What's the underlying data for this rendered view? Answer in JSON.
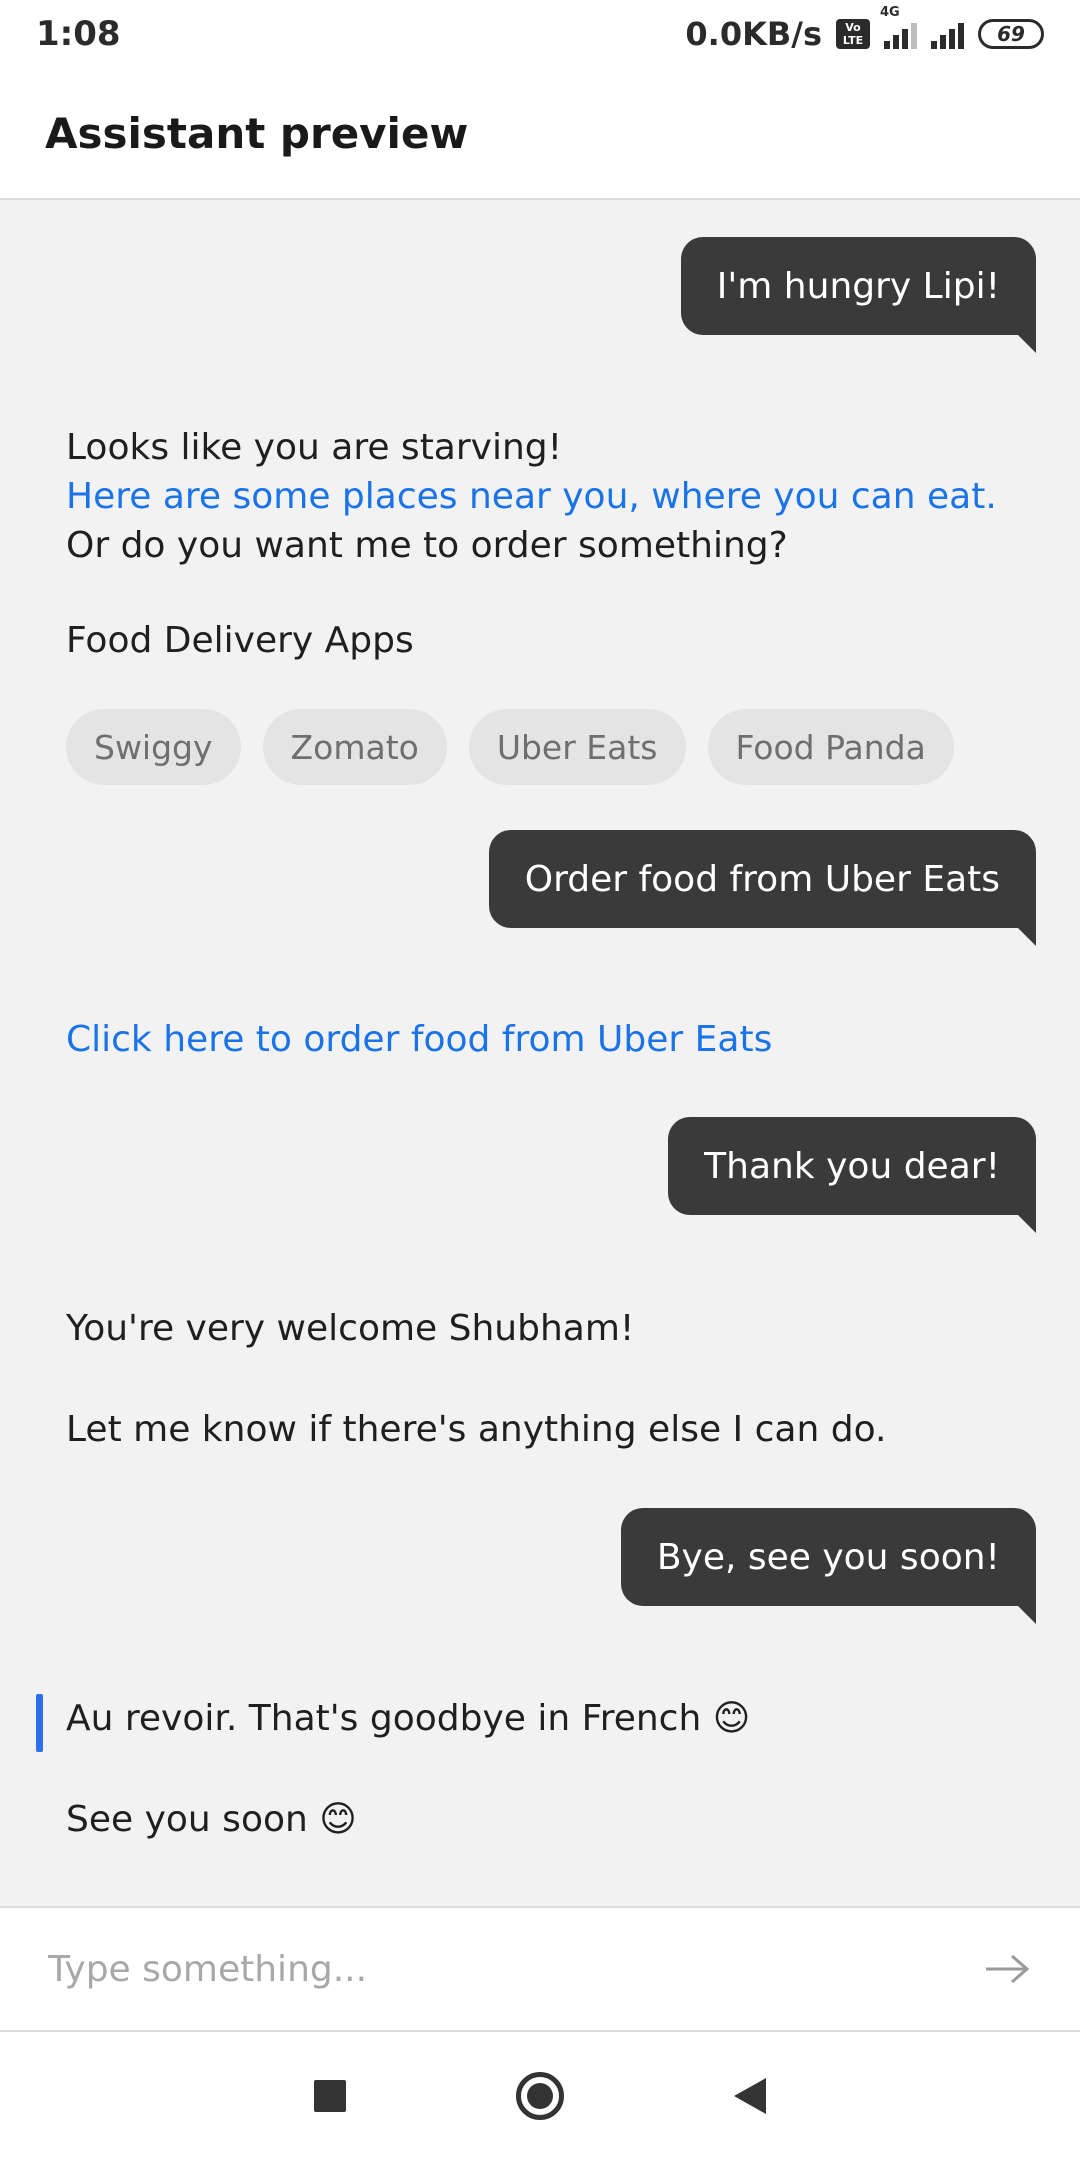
{
  "status_bar": {
    "time": "1:08",
    "network_speed": "0.0KB/s",
    "volte_label": "Vo\nLTE",
    "network_type": "4G",
    "battery_level": "69"
  },
  "app_bar": {
    "title": "Assistant preview"
  },
  "conversation": {
    "user_1": "I'm hungry Lipi!",
    "bot_1_line_1": "Looks like you are starving!",
    "bot_1_link": "Here are some places near you, where you can eat.",
    "bot_1_line_3": "Or do you want me to order something?",
    "bot_1_section_title": "Food Delivery Apps",
    "chips": [
      "Swiggy",
      "Zomato",
      "Uber Eats",
      "Food Panda"
    ],
    "user_2": "Order food from Uber Eats",
    "bot_2_link": "Click here to order food from Uber Eats",
    "user_3": "Thank you dear!",
    "bot_3_line_1": "You're very welcome Shubham!",
    "bot_3_line_2": "Let me know if there's anything else I can do.",
    "user_4": "Bye, see you soon!",
    "bot_4_line_1": "Au revoir. That's goodbye in French 😊",
    "bot_4_line_2": "See you soon 😊"
  },
  "input": {
    "placeholder": "Type something...",
    "value": ""
  },
  "colors": {
    "accent": "#1a73e8",
    "user_bubble": "#3a3a3a",
    "chat_background": "#f2f2f2"
  },
  "icons": {
    "send": "arrow-right-icon",
    "nav_recents": "square-icon",
    "nav_home": "circle-icon",
    "nav_back": "triangle-back-icon"
  }
}
